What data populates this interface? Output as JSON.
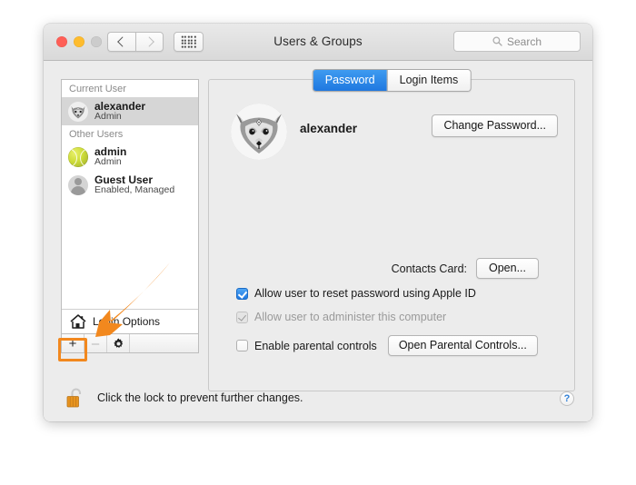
{
  "window": {
    "title": "Users & Groups",
    "traffic_lights": [
      "close",
      "minimize",
      "maximize"
    ],
    "nav": {
      "back_icon": "chevron-left-icon",
      "forward_icon": "chevron-right-icon",
      "show_all_icon": "grid-dots-icon"
    },
    "search": {
      "placeholder": "Search",
      "icon": "search-icon",
      "value": ""
    }
  },
  "sidebar": {
    "groups": [
      {
        "header": "Current User",
        "users": [
          {
            "name": "alexander",
            "role": "Admin",
            "icon": "fox-avatar-icon",
            "selected": true
          }
        ]
      },
      {
        "header": "Other Users",
        "users": [
          {
            "name": "admin",
            "role": "Admin",
            "icon": "tennis-ball-avatar-icon",
            "selected": false
          },
          {
            "name": "Guest User",
            "role": "Enabled, Managed",
            "icon": "person-silhouette-icon",
            "selected": false
          }
        ]
      }
    ],
    "login_options": {
      "label": "Login Options",
      "icon": "home-icon"
    },
    "toolbar": {
      "add_label": "+",
      "remove_label": "–",
      "settings_icon": "gear-icon",
      "add_enabled": true,
      "remove_enabled": false
    }
  },
  "content": {
    "tabs": [
      {
        "label": "Password",
        "active": true
      },
      {
        "label": "Login Items",
        "active": false
      }
    ],
    "account": {
      "avatar_icon": "fox-avatar-icon",
      "name": "alexander",
      "change_password_label": "Change Password..."
    },
    "contacts_card": {
      "label": "Contacts Card:",
      "button_label": "Open..."
    },
    "checkboxes": [
      {
        "label": "Allow user to reset password using Apple ID",
        "checked": true,
        "enabled": true
      },
      {
        "label": "Allow user to administer this computer",
        "checked": true,
        "enabled": false
      },
      {
        "label": "Enable parental controls",
        "checked": false,
        "enabled": true,
        "button_label": "Open Parental Controls..."
      }
    ]
  },
  "footer": {
    "lock_icon": "unlocked-padlock-icon",
    "lock_text": "Click the lock to prevent further changes.",
    "help_label": "?",
    "help_icon": "help-question-icon"
  },
  "annotation": {
    "arrow_icon": "pointer-arrow-icon",
    "arrow_color": "#F2881E",
    "highlight_color": "#F2881E",
    "highlight_target": "add-user-button"
  }
}
